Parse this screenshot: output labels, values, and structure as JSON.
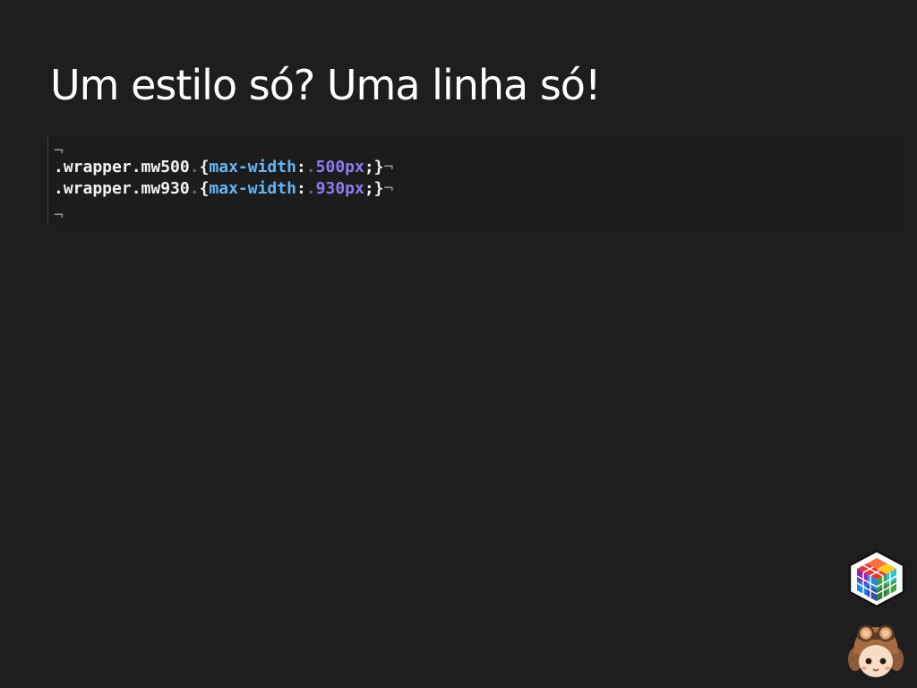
{
  "slide": {
    "title": "Um estilo só? Uma linha só!"
  },
  "code": {
    "eol_marker": "¬",
    "lines": [
      {
        "blank": true
      },
      {
        "selector": ".wrapper.mw500",
        "ws": ".",
        "open": "{",
        "property": "max-width",
        "colon": ":",
        "ws2": ".",
        "value": "500px",
        "semi": ";",
        "close": "}"
      },
      {
        "selector": ".wrapper.mw930",
        "ws": ".",
        "open": "{",
        "property": "max-width",
        "colon": ":",
        "ws2": ".",
        "value": "930px",
        "semi": ";",
        "close": "}"
      },
      {
        "blank": true
      }
    ]
  },
  "icons": {
    "logo": "cube-logo-icon",
    "mascot": "aviator-mascot-icon"
  },
  "colors": {
    "background": "#1e1e1e",
    "text": "#ffffff",
    "property": "#64b5f6",
    "value": "#8c7cf2"
  }
}
